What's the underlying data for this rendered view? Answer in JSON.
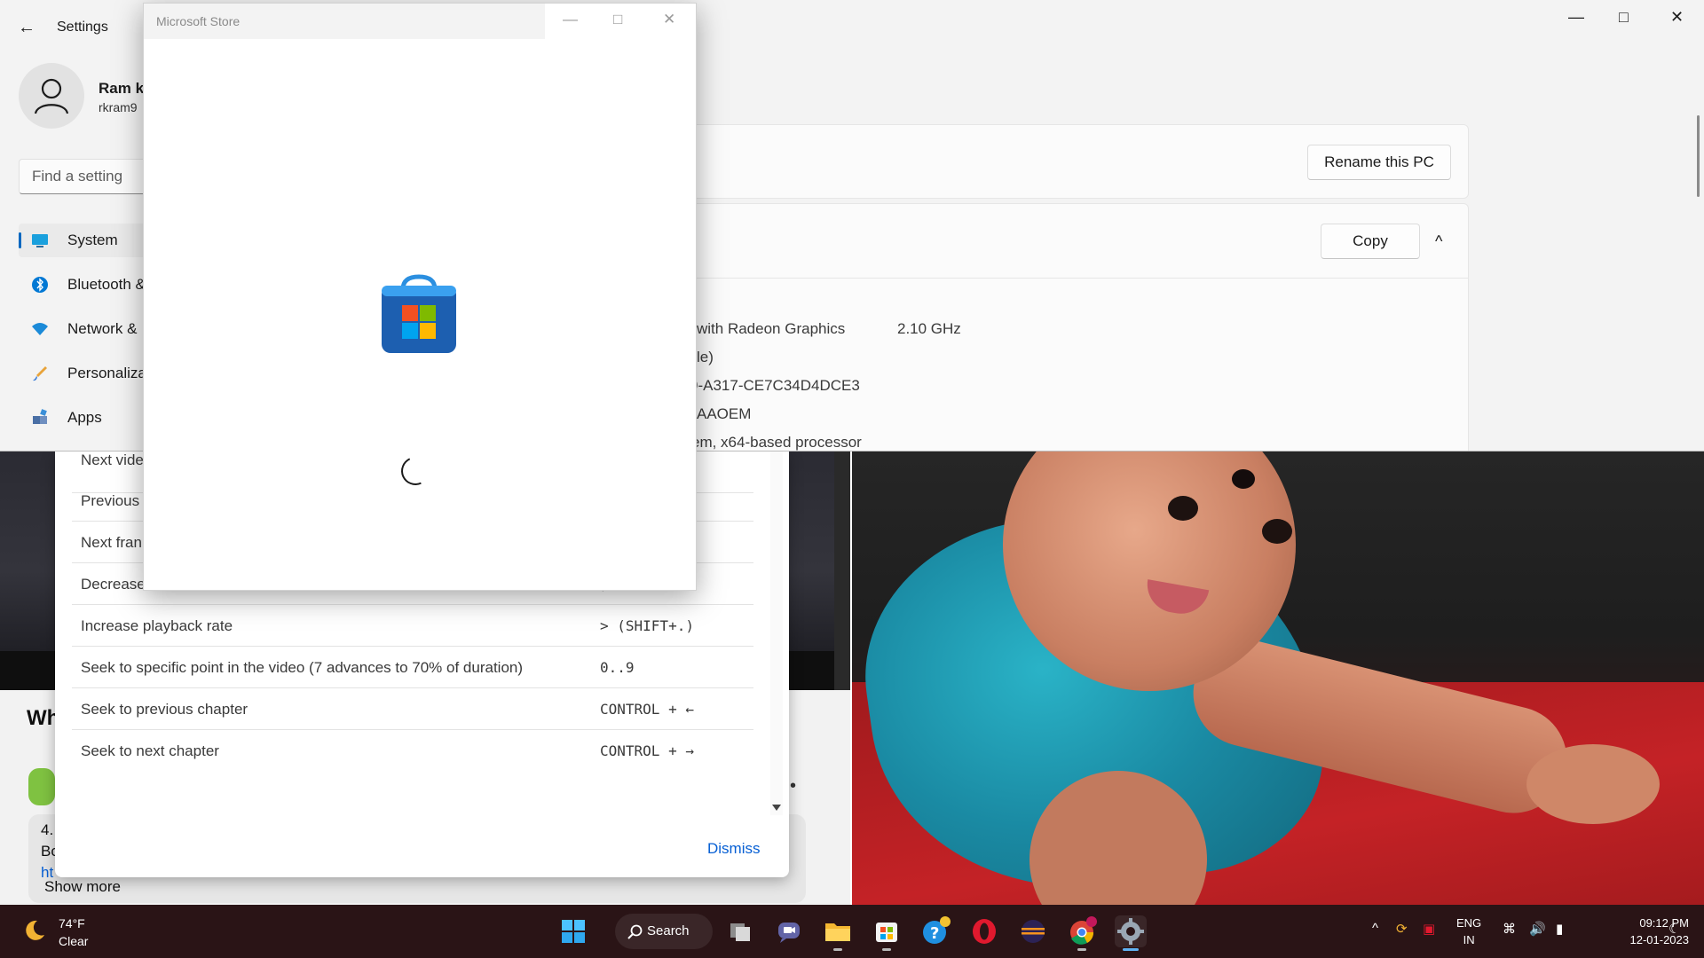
{
  "settings": {
    "title": "Settings",
    "user_name": "Ram k",
    "user_email": "rkram9",
    "search_placeholder": "Find a setting",
    "nav": [
      {
        "label": "System",
        "icon": "monitor-icon",
        "selected": true
      },
      {
        "label": "Bluetooth &",
        "icon": "bluetooth-icon",
        "selected": false
      },
      {
        "label": "Network &",
        "icon": "wifi-icon",
        "selected": false
      },
      {
        "label": "Personaliza",
        "icon": "brush-icon",
        "selected": false
      },
      {
        "label": "Apps",
        "icon": "apps-icon",
        "selected": false
      }
    ],
    "rename_button": "Rename this PC",
    "copy_button": "Copy",
    "specs": {
      "processor": "with Radeon Graphics",
      "speed": "2.10 GHz",
      "ram": "le)",
      "device_id": "9-A317-CE7C34D4DCE3",
      "product_id": "AAOEM",
      "system_type": "em, x64-based processor"
    },
    "accent_color": "#0067c0"
  },
  "store": {
    "title": "Microsoft Store",
    "loading": true
  },
  "shortcuts": {
    "rows": [
      {
        "label": "Next vide",
        "key": ")"
      },
      {
        "label": "Previous",
        "key": ""
      },
      {
        "label": "Next fran",
        "key": ""
      },
      {
        "label": "Decrease",
        "key": ")"
      },
      {
        "label": "Increase playback rate",
        "key": "> (SHIFT+.)"
      },
      {
        "label": "Seek to specific point in the video (7 advances to 70% of duration)",
        "key": "0..9"
      },
      {
        "label": "Seek to previous chapter",
        "key": "CONTROL + ←"
      },
      {
        "label": "Seek to next chapter",
        "key": "CONTROL + →"
      }
    ],
    "dismiss": "Dismiss",
    "dismiss_color": "#065fd4"
  },
  "youtube": {
    "heading_partial": "Wh",
    "desc_line1": "4.",
    "desc_line2": "Bo",
    "desc_line3": "ht",
    "show_more": "Show more"
  },
  "taskbar": {
    "temperature": "74°F",
    "condition": "Clear",
    "search_label": "Search",
    "language": "ENG",
    "region": "IN",
    "time": "09:12 PM",
    "date": "12-01-2023",
    "apps": [
      "start-icon",
      "task-view-icon",
      "teams-chat-icon",
      "file-explorer-icon",
      "microsoft-store-icon",
      "get-help-icon",
      "opera-icon",
      "eclipse-icon",
      "chrome-icon",
      "settings-icon"
    ]
  }
}
